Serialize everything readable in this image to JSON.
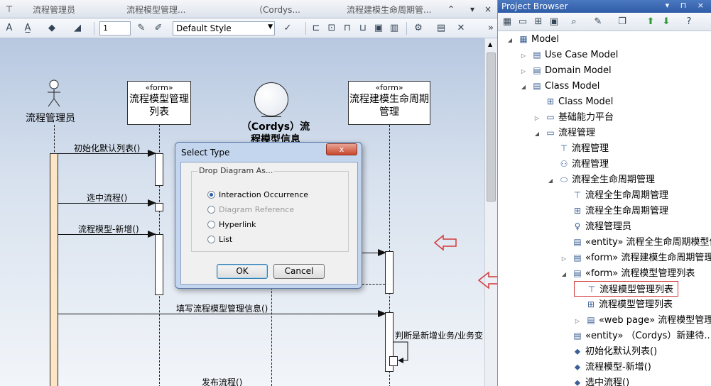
{
  "tabs": [
    {
      "label": "流程管理员"
    },
    {
      "label": "流程模型管理..."
    },
    {
      "label": "（Cordys..."
    },
    {
      "label": "流程建模生命周期管..."
    }
  ],
  "tab_controls": {
    "collapse": "⌃",
    "close": "×"
  },
  "toolbar": {
    "zoom_value": "1",
    "style_value": "Default Style"
  },
  "diagram": {
    "lifelines": [
      {
        "name": "流程管理员"
      },
      {
        "stereotype": "«form»",
        "name": "流程模型管理列表"
      },
      {
        "name": "（Cordys）流程模型信息"
      },
      {
        "stereotype": "«form»",
        "name": "流程建模生命周期管理"
      }
    ],
    "messages": [
      {
        "label": "初始化默认列表()"
      },
      {
        "label": "选中流程()"
      },
      {
        "label": "流程模型-新增()"
      },
      {
        "label": "填写流程模型管理信息()"
      },
      {
        "label": "判断是新增业务/业务变"
      },
      {
        "label": "发布流程()"
      }
    ]
  },
  "dialog": {
    "title": "Select Type",
    "close_label": "x",
    "group_label": "Drop Diagram As...",
    "options": [
      {
        "label": "Interaction Occurrence",
        "selected": true,
        "enabled": true
      },
      {
        "label": "Diagram Reference",
        "selected": false,
        "enabled": false
      },
      {
        "label": "Hyperlink",
        "selected": false,
        "enabled": true
      },
      {
        "label": "List",
        "selected": false,
        "enabled": true
      }
    ],
    "ok_label": "OK",
    "cancel_label": "Cancel"
  },
  "browser": {
    "title": "Project Browser",
    "header_buttons": "▾ ⊓ ×",
    "tree": [
      {
        "label": "Model",
        "toggle": "◢",
        "icon": "model-icon",
        "glyph": "▦"
      },
      {
        "label": "Use Case Model",
        "toggle": "▷",
        "icon": "package-icon",
        "glyph": "▤"
      },
      {
        "label": "Domain Model",
        "toggle": "▷",
        "icon": "package-icon",
        "glyph": "▤"
      },
      {
        "label": "Class Model",
        "toggle": "◢",
        "icon": "package-icon",
        "glyph": "▤"
      },
      {
        "label": "Class Model",
        "toggle": "",
        "icon": "class-diagram-icon",
        "glyph": "⊞"
      },
      {
        "label": "基础能力平台",
        "toggle": "▷",
        "icon": "folder-icon",
        "glyph": "▭"
      },
      {
        "label": "流程管理",
        "toggle": "◢",
        "icon": "folder-icon",
        "glyph": "▭"
      },
      {
        "label": "流程管理",
        "toggle": "",
        "icon": "sequence-diagram-icon",
        "glyph": "⊤"
      },
      {
        "label": "流程管理",
        "toggle": "",
        "icon": "usecase-diagram-icon",
        "glyph": "⚇"
      },
      {
        "label": "流程全生命周期管理",
        "toggle": "◢",
        "icon": "usecase-icon",
        "glyph": "⬭"
      },
      {
        "label": "流程全生命周期管理",
        "toggle": "",
        "icon": "sequence-diagram-icon",
        "glyph": "⊤"
      },
      {
        "label": "流程全生命周期管理",
        "toggle": "",
        "icon": "class-diagram-icon",
        "glyph": "⊞"
      },
      {
        "label": "流程管理员",
        "toggle": "",
        "icon": "actor-icon",
        "glyph": "♀"
      },
      {
        "label": "«entity» 流程全生命周期模型信...",
        "toggle": "",
        "icon": "class-icon",
        "glyph": "▤"
      },
      {
        "label": "«form» 流程建模生命周期管理",
        "toggle": "▷",
        "icon": "class-icon",
        "glyph": "▤"
      },
      {
        "label": "«form» 流程模型管理列表",
        "toggle": "◢",
        "icon": "class-icon",
        "glyph": "▤"
      },
      {
        "label": "流程模型管理列表",
        "toggle": "",
        "icon": "sequence-diagram-icon",
        "glyph": "⊤",
        "selected": true
      },
      {
        "label": "流程模型管理列表",
        "toggle": "",
        "icon": "class-diagram-icon",
        "glyph": "⊞"
      },
      {
        "label": "«web page» 流程模型管理...",
        "toggle": "▷",
        "icon": "class-icon",
        "glyph": "▤"
      },
      {
        "label": "«entity» （Cordys）新建待...",
        "toggle": "",
        "icon": "class-icon",
        "glyph": "▤"
      },
      {
        "label": "初始化默认列表()",
        "toggle": "",
        "icon": "operation-icon",
        "glyph": "⬥"
      },
      {
        "label": "流程模型-新增()",
        "toggle": "",
        "icon": "operation-icon",
        "glyph": "⬥"
      },
      {
        "label": "选中流程()",
        "toggle": "",
        "icon": "operation-icon",
        "glyph": "⬥"
      }
    ]
  },
  "colors": {
    "activation_actor": "#fde6c6",
    "annotation_red": "#d23b3b",
    "header_blue": "#3b68b2"
  }
}
